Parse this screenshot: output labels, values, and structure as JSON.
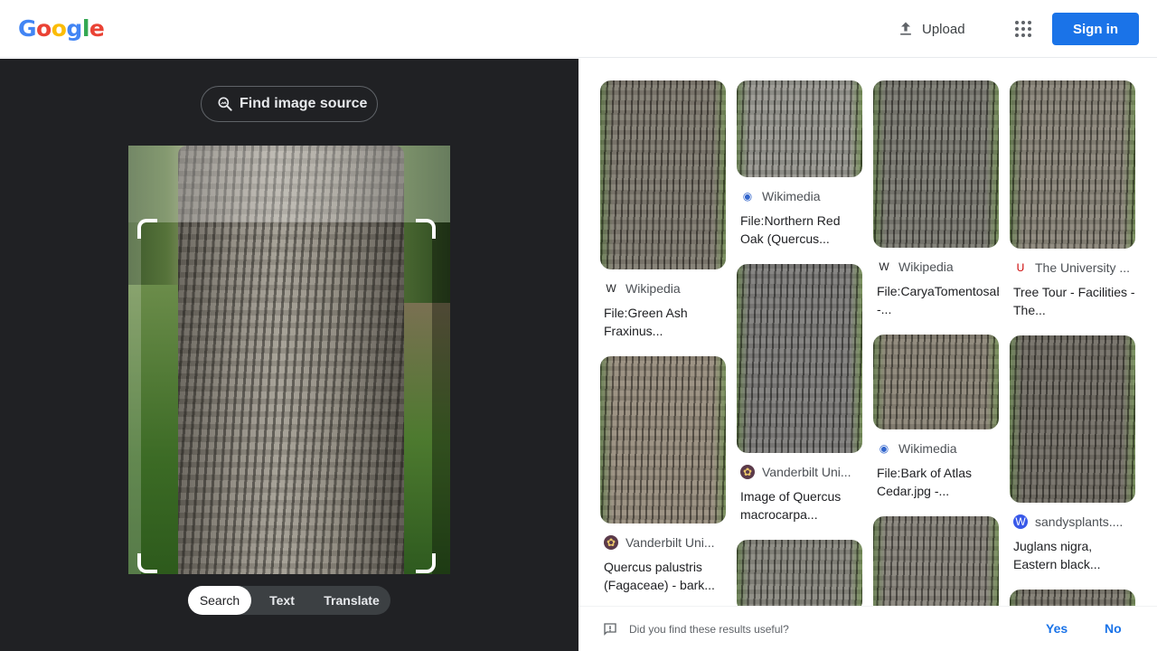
{
  "header": {
    "logo_letters": [
      {
        "ch": "G",
        "color": "#4285F4"
      },
      {
        "ch": "o",
        "color": "#EA4335"
      },
      {
        "ch": "o",
        "color": "#FBBC05"
      },
      {
        "ch": "g",
        "color": "#4285F4"
      },
      {
        "ch": "l",
        "color": "#34A853"
      },
      {
        "ch": "e",
        "color": "#EA4335"
      }
    ],
    "upload_label": "Upload",
    "signin_label": "Sign in"
  },
  "left": {
    "find_source_label": "Find image source",
    "tabs": [
      "Search",
      "Text",
      "Translate"
    ],
    "active_tab": "Search"
  },
  "results": {
    "columns": [
      [
        {
          "source": "Wikipedia",
          "favicon": "wikipedia-icon",
          "title": "File:Green Ash Fraxinus...",
          "tone": "#6f6a5f"
        },
        {
          "source": "Vanderbilt Uni...",
          "favicon": "vanderbilt-icon",
          "title": "Quercus palustris (Fagaceae) - bark...",
          "tone": "#8a7e6e"
        }
      ],
      [
        {
          "source": "Wikimedia",
          "favicon": "wikimedia-icon",
          "title": "File:Northern Red Oak (Quercus...",
          "tone": "#8c8c86"
        },
        {
          "source": "Vanderbilt Uni...",
          "favicon": "vanderbilt-icon",
          "title": "Image of Quercus macrocarpa...",
          "tone": "#6c6c6c"
        },
        {
          "source": "",
          "favicon": "",
          "title": "",
          "tone": "#7a7a72"
        }
      ],
      [
        {
          "source": "Wikipedia",
          "favicon": "wikipedia-icon",
          "title": "File:CaryaTomentosaBark.jpg -...",
          "tone": "#6a6a62"
        },
        {
          "source": "Wikimedia",
          "favicon": "wikimedia-icon",
          "title": "File:Bark of Atlas Cedar.jpg -...",
          "tone": "#7c7566"
        },
        {
          "source": "",
          "favicon": "",
          "title": "",
          "tone": "#77736b"
        }
      ],
      [
        {
          "source": "The University ...",
          "favicon": "university-icon",
          "title": "Tree Tour - Facilities - The...",
          "tone": "#7b766a"
        },
        {
          "source": "sandysplants....",
          "favicon": "wordpress-icon",
          "title": "Juglans nigra, Eastern black...",
          "tone": "#5e5a52"
        },
        {
          "source": "",
          "favicon": "",
          "title": "",
          "tone": "#6e6a60"
        }
      ]
    ]
  },
  "feedback": {
    "question": "Did you find these results useful?",
    "yes": "Yes",
    "no": "No"
  }
}
